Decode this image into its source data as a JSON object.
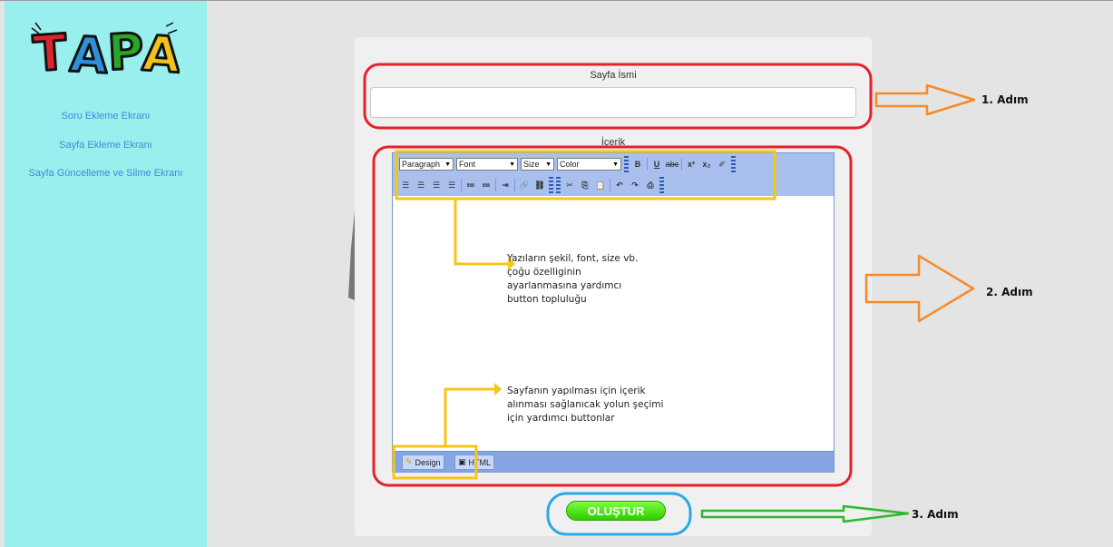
{
  "sidebar": {
    "logo_text": "TAPA",
    "items": [
      {
        "label": "Soru Ekleme Ekranı"
      },
      {
        "label": "Sayfa Ekleme Ekranı"
      },
      {
        "label": "Sayfa Güncelleme ve Silme Ekranı"
      }
    ]
  },
  "form": {
    "page_name_label": "Sayfa İsmi",
    "page_name_value": "",
    "content_label": "İçerik",
    "submit_label": "OLUŞTUR"
  },
  "editor": {
    "paragraph_select": "Paragraph",
    "font_select": "Font",
    "size_select": "Size",
    "color_select": "Color",
    "design_tab": "Design",
    "html_tab": "HTML"
  },
  "annotations": {
    "toolbar_note": [
      "Yazıların şekil, font, size vb.",
      "çoğu özelliginin",
      "ayarlanmasına yardımcı",
      "button topluluğu"
    ],
    "mode_note": [
      "Sayfanın yapılması için içerik",
      "alınması sağlanıcak yolun şeçimi",
      "için yardımcı buttonlar"
    ],
    "step1": "1. Adım",
    "step2": "2. Adım",
    "step3": "3. Adım"
  },
  "colors": {
    "sidebar_bg": "#99eeee",
    "nav_link": "#3a8fd8",
    "highlight_red": "#e8202a",
    "highlight_yellow": "#f5c518",
    "arrow_orange": "#f58a2a",
    "arrow_green": "#2fb82f",
    "highlight_blue": "#2aa8e8",
    "submit_green": "#2fcc00"
  }
}
